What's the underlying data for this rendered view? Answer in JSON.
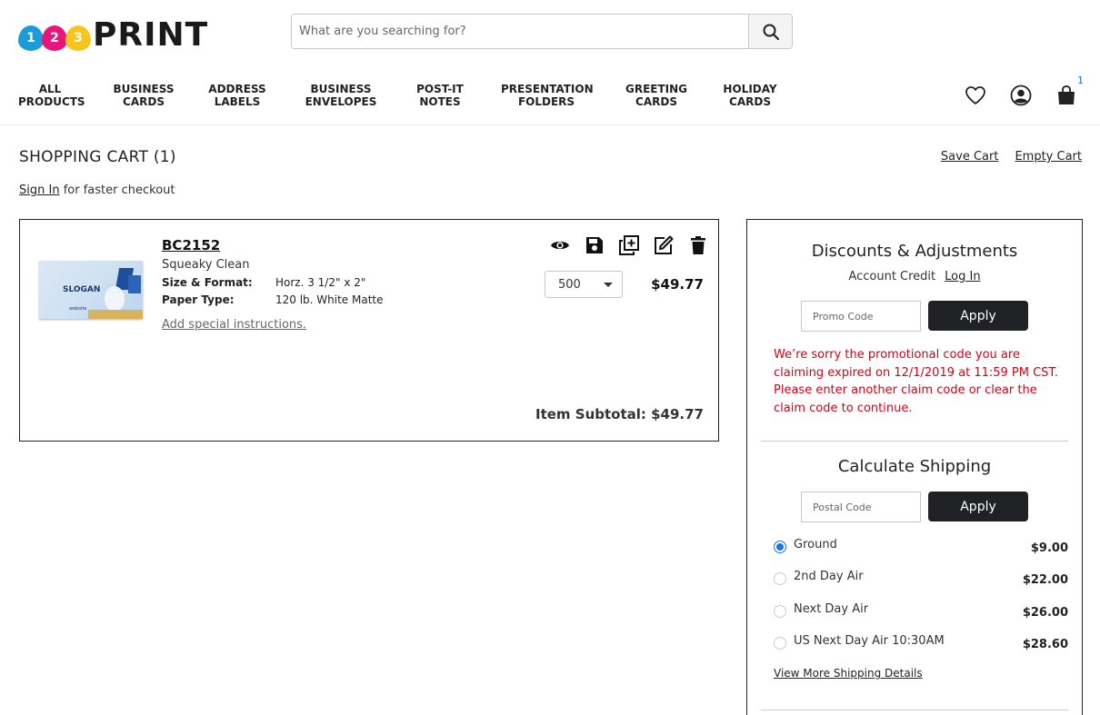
{
  "logo": {
    "digits": [
      "1",
      "2",
      "3"
    ],
    "text": "PRINT",
    "colors": [
      "#1b9bd7",
      "#e8157c",
      "#f7c51e"
    ]
  },
  "search": {
    "placeholder": "What are you searching for?"
  },
  "nav": {
    "items": [
      {
        "label": "ALL\nPRODUCTS"
      },
      {
        "label": "BUSINESS\nCARDS"
      },
      {
        "label": "ADDRESS\nLABELS"
      },
      {
        "label": "BUSINESS\nENVELOPES"
      },
      {
        "label": "POST-IT\nNOTES"
      },
      {
        "label": "PRESENTATION\nFOLDERS"
      },
      {
        "label": "GREETING\nCARDS"
      },
      {
        "label": "HOLIDAY\nCARDS"
      }
    ],
    "cart_count": "1",
    "icons": [
      "heart-icon",
      "user-icon",
      "shopping-bag-icon"
    ]
  },
  "page": {
    "title": "SHOPPING CART (1)",
    "save_cart": "Save Cart",
    "empty_cart": "Empty Cart",
    "sign_in": "Sign In",
    "sign_in_suffix": " for faster checkout"
  },
  "item": {
    "sku": "BC2152",
    "name": "Squeaky Clean",
    "specs": [
      {
        "label": "Size & Format:",
        "value": "Horz. 3 1/2\" x 2\""
      },
      {
        "label": "Paper Type:",
        "value": "120 lb. White Matte"
      }
    ],
    "special_instructions": "Add special instructions.",
    "quantity": "500",
    "price": "$49.77",
    "subtotal": "Item Subtotal: $49.77",
    "thumb_text": "SLOGAN",
    "thumb_web": "website",
    "actions": [
      "eye-icon",
      "save-icon",
      "duplicate-icon",
      "edit-icon",
      "trash-icon"
    ]
  },
  "discounts": {
    "heading": "Discounts & Adjustments",
    "account_credit": "Account Credit",
    "log_in": "Log In",
    "promo_placeholder": "Promo Code",
    "apply": "Apply",
    "error": "We’re sorry the promotional code you are claiming expired on 12/1/2019 at 11:59 PM CST. Please enter another claim code or clear the claim code to continue."
  },
  "shipping": {
    "heading": "Calculate Shipping",
    "postal_placeholder": "Postal Code",
    "apply": "Apply",
    "options": [
      {
        "name": "Ground",
        "price": "$9.00",
        "selected": true
      },
      {
        "name": "2nd Day Air",
        "price": "$22.00",
        "selected": false
      },
      {
        "name": "Next Day Air",
        "price": "$26.00",
        "selected": false
      },
      {
        "name": "US Next Day Air 10:30AM",
        "price": "$28.60",
        "selected": false
      }
    ],
    "more": "View More Shipping Details"
  },
  "colors": {
    "error": "#d0021b",
    "button": "#202124",
    "radio_selected": "#1a73e8"
  }
}
